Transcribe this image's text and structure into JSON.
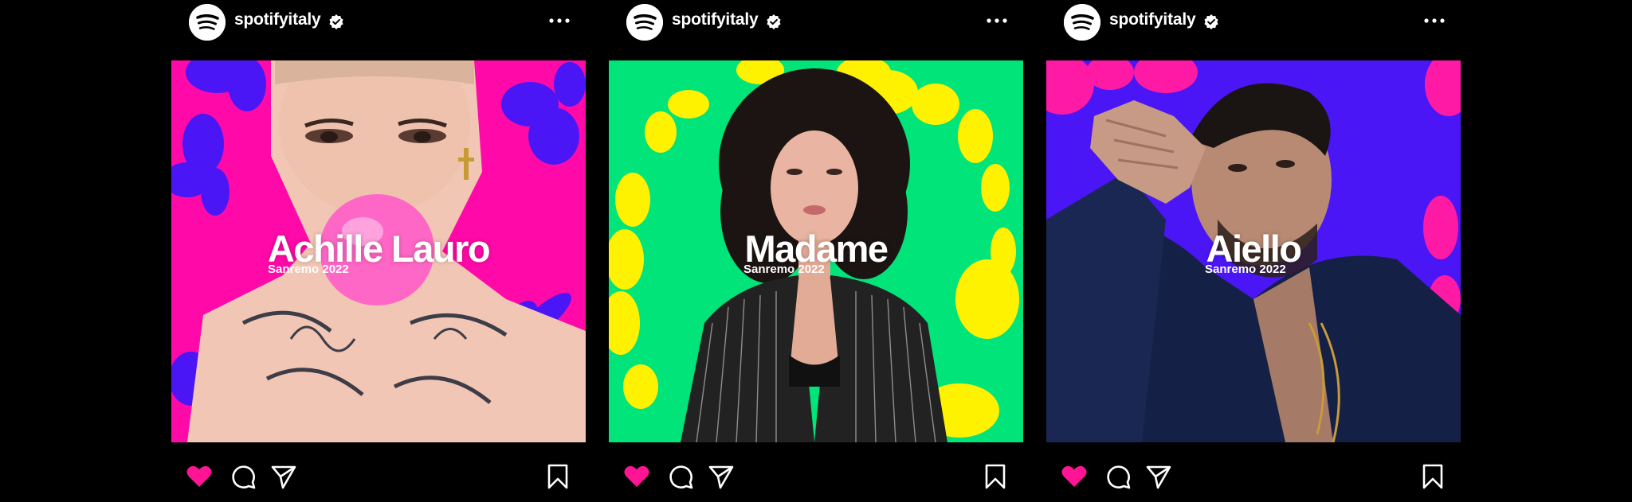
{
  "account": {
    "username": "spotifyitaly",
    "verified": true,
    "avatar_icon": "spotify-logo-icon",
    "more_icon": "more-options-icon"
  },
  "actions": {
    "like_icon": "heart-icon",
    "like_color": "#ff1493",
    "comment_icon": "comment-icon",
    "share_icon": "send-icon",
    "save_icon": "bookmark-icon"
  },
  "posts": [
    {
      "artist": "Achille Lauro",
      "subtitle": "Sanremo 2022",
      "background_color": "#ff0aa8",
      "flower_color": "#4b16f5",
      "liked": true
    },
    {
      "artist": "Madame",
      "subtitle": "Sanremo 2022",
      "background_color": "#00e47a",
      "flower_color": "#fff200",
      "liked": true
    },
    {
      "artist": "Aiello",
      "subtitle": "Sanremo 2022",
      "background_color": "#4b16f5",
      "flower_color": "#ff1aa6",
      "liked": true
    }
  ]
}
